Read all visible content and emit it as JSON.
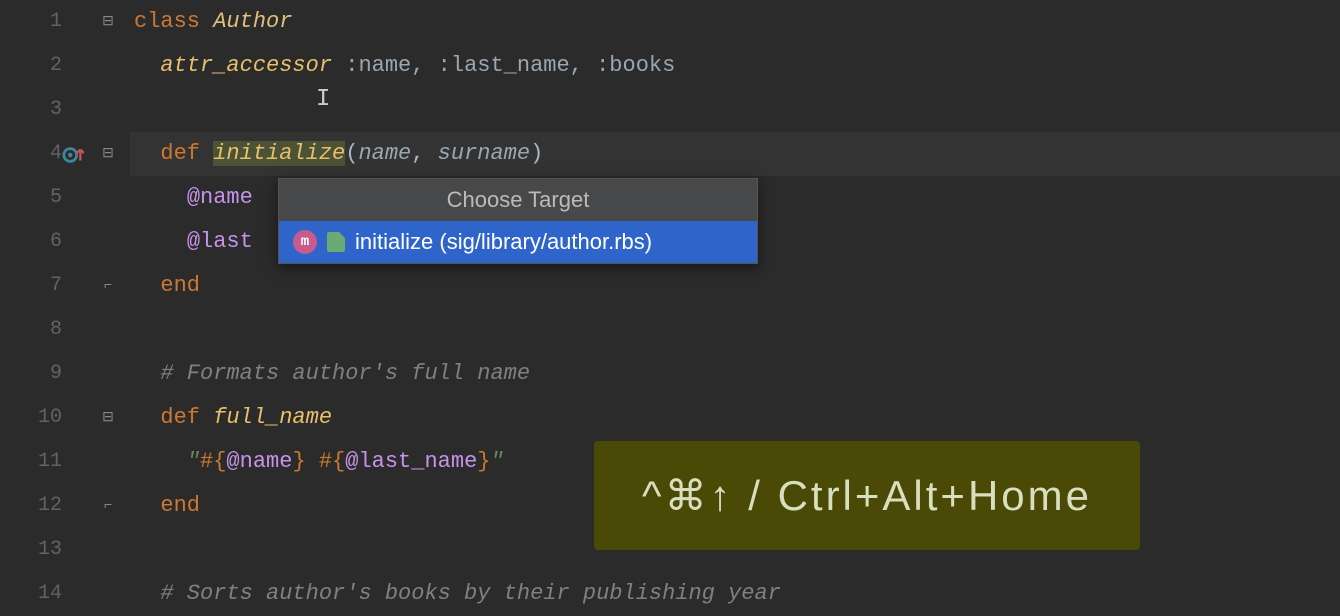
{
  "gutter": {
    "lines": [
      "1",
      "2",
      "3",
      "4",
      "5",
      "6",
      "7",
      "8",
      "9",
      "10",
      "11",
      "12",
      "13",
      "14"
    ]
  },
  "code": {
    "l1": {
      "kw": "class ",
      "cls": "Author"
    },
    "l2": {
      "fn": "attr_accessor ",
      "args": ":name, :last_name, :books"
    },
    "l4": {
      "kw": "def ",
      "name": "initialize",
      "open": "(",
      "p1": "name",
      "comma": ", ",
      "p2": "surname",
      "close": ")"
    },
    "l5": {
      "ivar": "@name"
    },
    "l6": {
      "ivar": "@last"
    },
    "l7": {
      "end": "end"
    },
    "l9": {
      "comment": "# Formats author's full name"
    },
    "l10": {
      "kw": "def ",
      "name": "full_name"
    },
    "l11": {
      "q1": "\"",
      "i1o": "#{",
      "v1": "@name",
      "i1c": "}",
      "sp": " ",
      "i2o": "#{",
      "v2": "@last_name",
      "i2c": "}",
      "q2": "\""
    },
    "l12": {
      "end": "end"
    },
    "l14": {
      "comment": "# Sorts author's books by their publishing year"
    }
  },
  "popup": {
    "title": "Choose Target",
    "item_label": "initialize (sig/library/author.rbs)"
  },
  "shortcut": {
    "text": "^⌘↑ / Ctrl+Alt+Home"
  }
}
